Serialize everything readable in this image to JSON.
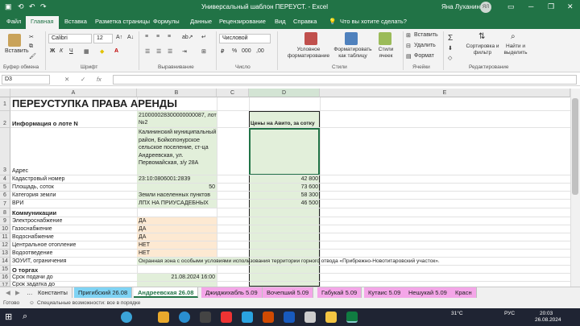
{
  "titlebar": {
    "title": "Универсальный шаблон ПЕРЕУСТ. - Excel",
    "user": "Яна Луханина",
    "avatar_initials": "ЯЛ"
  },
  "ribbon_tabs": [
    "Файл",
    "Главная",
    "Вставка",
    "Разметка страницы",
    "Формулы",
    "Данные",
    "Рецензирование",
    "Вид",
    "Справка",
    "Что вы хотите сделать?"
  ],
  "ribbon": {
    "paste": "Вставить",
    "font_name": "Calibri",
    "font_size": "12",
    "number_format": "Числовой",
    "conditional": "Условное форматирование",
    "format_table": "Форматировать как таблицу",
    "cell_styles": "Стили ячеек",
    "insert": "Вставить",
    "delete": "Удалить",
    "format": "Формат",
    "sort_filter": "Сортировка и фильтр",
    "find": "Найти и выделить",
    "groups": {
      "clipboard": "Буфер обмена",
      "font": "Шрифт",
      "alignment": "Выравнивание",
      "number": "Число",
      "styles": "Стили",
      "cells": "Ячейки",
      "editing": "Редактирование"
    }
  },
  "formula_bar": {
    "name_box": "D3",
    "fx": "fx",
    "value": ""
  },
  "columns": [
    "A",
    "B",
    "C",
    "D",
    "E"
  ],
  "rows": [
    {
      "n": "1",
      "a": "ПЕРЕУСТУПКА ПРАВА АРЕНДЫ",
      "b": "",
      "d": ""
    },
    {
      "n": "2",
      "a": "Информация о лоте N",
      "b": "210000028300000000087, лот №2",
      "d": "Цены на Авито, за сотку"
    },
    {
      "n": "3",
      "a": "Адрес",
      "b": "Калининский муниципальный район, Бойкопонурское сельское поселение, ст-ца Андреевская, ул. Первомайская, з/у 28А",
      "d": ""
    },
    {
      "n": "4",
      "a": "Кадастровый номер",
      "b": "23:10:0806001:2839",
      "d": "42 800"
    },
    {
      "n": "5",
      "a": "Площадь, соток",
      "b": "50",
      "d": "73 600"
    },
    {
      "n": "6",
      "a": "Категория земли",
      "b": "Земли населенных пунктов",
      "d": "58 300"
    },
    {
      "n": "7",
      "a": "ВРИ",
      "b": "ЛПХ НА ПРИУСАДЕБНЫХ",
      "d": "46 500"
    },
    {
      "n": "8",
      "a": "Коммуникации",
      "b": "",
      "d": ""
    },
    {
      "n": "9",
      "a": "Электроснабжение",
      "b": "ДА",
      "d": ""
    },
    {
      "n": "10",
      "a": "Газоснабжение",
      "b": "ДА",
      "d": ""
    },
    {
      "n": "11",
      "a": "Водоснабжение",
      "b": "ДА",
      "d": ""
    },
    {
      "n": "12",
      "a": "Центральное отопление",
      "b": "НЕТ",
      "d": ""
    },
    {
      "n": "13",
      "a": "Водоотведение",
      "b": "НЕТ",
      "d": ""
    },
    {
      "n": "14",
      "a": "ЗОУИТ, ограничения",
      "b": "Охранная зона с особыми условиями использования территории горного отвода «Прибрежно-Новотитаровский участок».",
      "d": ""
    },
    {
      "n": "15",
      "a": "О торгах",
      "b": "",
      "d": ""
    },
    {
      "n": "16",
      "a": "Срок подачи до",
      "b": "21.08.2024 16:00",
      "d": ""
    },
    {
      "n": "17",
      "a": "Срок задатка до",
      "b": "",
      "d": ""
    }
  ],
  "sheet_tabs": [
    "Константы",
    "Пригибский 26.08",
    "Андреевская 26.08",
    "Джиджихабль 5.09",
    "Вочепший 5.09",
    "Габукай 5.09",
    "Кутаис 5.09",
    "Нешукай 5.09",
    "Красн"
  ],
  "status": {
    "ready": "Готово",
    "accessibility": "Специальные возможности: все в порядке"
  },
  "taskbar": {
    "lang": "РУС",
    "time": "20:03",
    "date": "26.08.2024",
    "temp": "31°C"
  }
}
